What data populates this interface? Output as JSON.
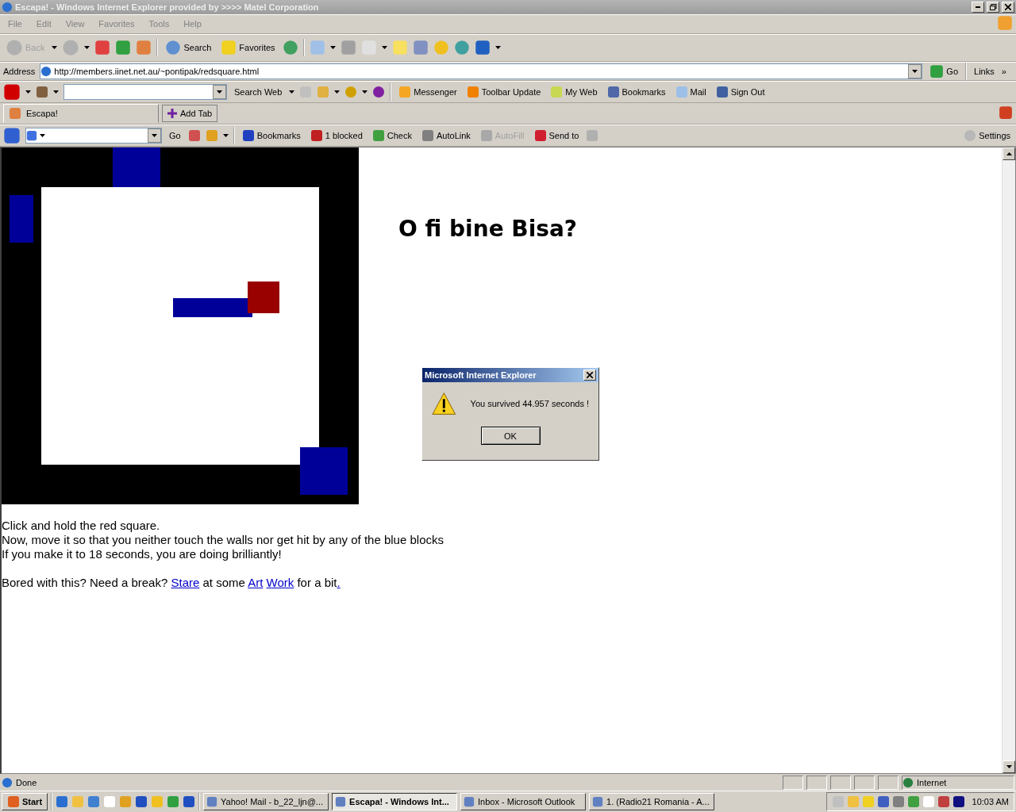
{
  "window": {
    "title": "Escapa! - Windows Internet Explorer provided by >>>> Matel Corporation"
  },
  "menu": [
    "File",
    "Edit",
    "View",
    "Favorites",
    "Tools",
    "Help"
  ],
  "toolbar": {
    "back": "Back",
    "search": "Search",
    "favorites": "Favorites"
  },
  "address": {
    "label": "Address",
    "value": "http://members.iinet.net.au/~pontipak/redsquare.html",
    "go": "Go",
    "links": "Links",
    "more": "»"
  },
  "yahoo_toolbar": {
    "search_button": "Search Web",
    "items": [
      "Messenger",
      "Toolbar Update",
      "My Web",
      "Bookmarks",
      "Mail",
      "Sign Out"
    ]
  },
  "tabs": [
    {
      "label": "Escapa!",
      "selected": true
    }
  ],
  "add_tab": "Add Tab",
  "google_toolbar": {
    "go": "Go",
    "items": [
      {
        "label": "Bookmarks",
        "disabled": false
      },
      {
        "label": "1 blocked",
        "disabled": false
      },
      {
        "label": "Check",
        "disabled": false
      },
      {
        "label": "AutoLink",
        "disabled": false
      },
      {
        "label": "AutoFill",
        "disabled": true
      },
      {
        "label": "Send to",
        "disabled": false
      }
    ],
    "settings": "Settings"
  },
  "page": {
    "heading": "O fi bine Bisa?",
    "instructions": [
      "Click and hold the red square.",
      "Now, move it so that you neither touch the walls nor get hit by any of the blue blocks",
      "If you make it to 18 seconds, you are doing brilliantly!"
    ],
    "break_text": [
      {
        "text": "Bored with this? Need a break?",
        "kind": "text"
      },
      {
        "text": "Stare",
        "kind": "link"
      },
      {
        "text": "at some",
        "kind": "text"
      },
      {
        "text": "Art",
        "kind": "link"
      },
      {
        "text": "Work",
        "kind": "link"
      },
      {
        "text": "for a bit",
        "kind": "text"
      },
      {
        "text": ".",
        "kind": "link",
        "tight": true
      }
    ]
  },
  "dialog": {
    "title": "Microsoft Internet Explorer",
    "message": "You survived 44.957 seconds !",
    "ok": "OK"
  },
  "status": {
    "text": "Done",
    "zone": "Internet"
  },
  "taskbar": {
    "start": "Start",
    "tasks": [
      {
        "label": "Yahoo! Mail - b_22_ljn@...",
        "selected": false
      },
      {
        "label": "Escapa! - Windows Int...",
        "selected": true
      },
      {
        "label": "Inbox - Microsoft Outlook",
        "selected": false
      },
      {
        "label": "1.  (Radio21 Romania - A...",
        "selected": false
      }
    ],
    "clock": "10:03 AM"
  }
}
